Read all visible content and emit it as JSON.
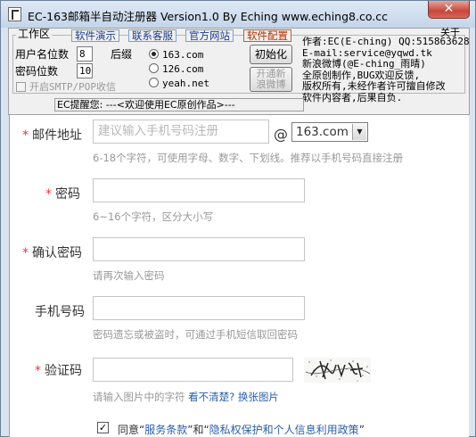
{
  "window": {
    "title": "EC-163邮箱半自动注册器 Version1.0 By Eching www.eching8.co.cc",
    "close_label": "✕"
  },
  "toolbar": {
    "group_title": "工作区",
    "tabs": [
      "软件演示",
      "联系客服",
      "官方网站",
      "软件配置"
    ],
    "about_label": "关于",
    "username_digits_label": "用户名位数",
    "username_digits_value": "8",
    "password_digits_label": "密码位数",
    "password_digits_value": "10",
    "suffix_label": "后缀",
    "suffix_options": [
      "163.com",
      "126.com",
      "yeah.net"
    ],
    "suffix_selected": "163.com",
    "init_button": "初始化",
    "weibo_button_line1": "开通新",
    "weibo_button_line2": "浪微博",
    "smtp_checkbox_label": "开启SMTP/POP收信",
    "notice": "EC提醒您: ---<欢迎使用EC原创作品>---",
    "info_lines": [
      "作者:EC(E-ching) QQ:515863628",
      "E-mail:service@yqwd.tk",
      "新浪微博(@E-ching_雨晴)",
      "全原创制作,BUG欢迎反馈,",
      "版权所有,未经作者许可擅自修改",
      "软件内容者,后果自负."
    ]
  },
  "form": {
    "email": {
      "label": "邮件地址",
      "placeholder": "建议输入手机号码注册",
      "at": "@",
      "domain": "163.com",
      "hint": "6-18个字符，可使用字母、数字、下划线。推荐以手机号码直接注册"
    },
    "password": {
      "label": "密码",
      "hint": "6~16个字符，区分大小写"
    },
    "confirm": {
      "label": "确认密码",
      "hint": "请再次输入密码"
    },
    "phone": {
      "label": "手机号码",
      "hint": "密码遗忘或被盗时，可通过手机短信取回密码"
    },
    "captcha": {
      "label": "验证码",
      "hint": "请输入图片中的字符",
      "unclear": "看不清楚?",
      "change": "换张图片"
    },
    "agreement": {
      "checked": "☑",
      "prefix": "同意“",
      "terms": "服务条款",
      "middle": "”和“",
      "privacy": "隐私权保护和个人信息利用政策",
      "suffix": "”"
    },
    "required_mark": "*"
  },
  "colors": {
    "required": "#e4393c",
    "link": "#2a5fa8",
    "hint": "#999999"
  }
}
